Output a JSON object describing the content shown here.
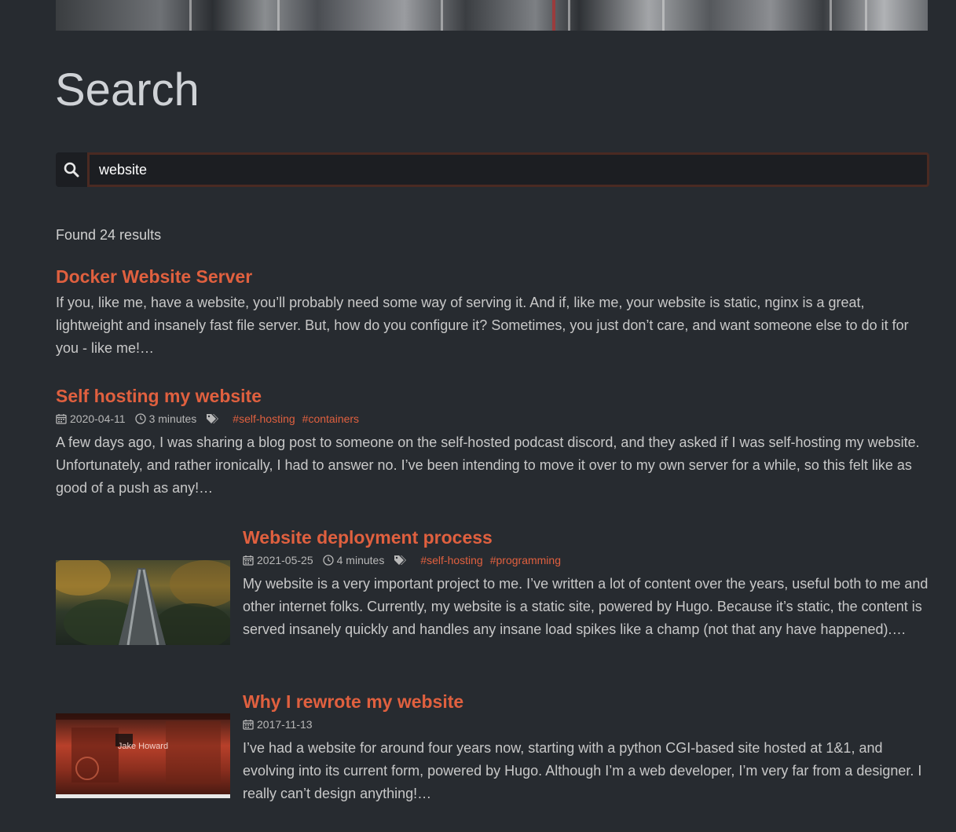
{
  "page": {
    "title": "Search"
  },
  "search": {
    "value": "website",
    "icon": "search-icon"
  },
  "results_count": "Found 24 results",
  "results": [
    {
      "title": "Docker Website Server",
      "summary": "If you, like me, have a website, you’ll probably need some way of serving it. And if, like me, your website is static, nginx is a great, lightweight and insanely fast file server. But, how do you configure it? Sometimes, you just don’t care, and want someone else to do it for you - like me!…"
    },
    {
      "title": "Self hosting my website",
      "date": "2020-04-11",
      "read_time": "3 minutes",
      "tags": [
        "#self-hosting",
        "#containers"
      ],
      "summary": "A few days ago, I was sharing a blog post to someone on the self-hosted podcast discord, and they asked if I was self-hosting my website. Unfortunately, and rather ironically, I had to answer no. I’ve been intending to move it over to my own server for a while, so this felt like as good of a push as any!…"
    },
    {
      "title": "Website deployment process",
      "date": "2021-05-25",
      "read_time": "4 minutes",
      "tags": [
        "#self-hosting",
        "#programming"
      ],
      "summary": "My website is a very important project to me. I’ve written a lot of content over the years, useful both to me and other internet folks. Currently, my website is a static site, powered by Hugo. Because it’s static, the content is served insanely quickly and handles any insane load spikes like a champ (not that any have happened).…"
    },
    {
      "title": "Why I rewrote my website",
      "date": "2017-11-13",
      "thumb_caption": "Jake Howard",
      "summary": "I’ve had a website for around four years now, starting with a python CGI-based site hosted at 1&1, and evolving into its current form, powered by Hugo. Although I’m a web developer, I’m very far from a designer. I really can’t design anything!…"
    }
  ],
  "colors": {
    "background": "#272b30",
    "accent": "#e0603f",
    "text": "#c8c8c8"
  }
}
